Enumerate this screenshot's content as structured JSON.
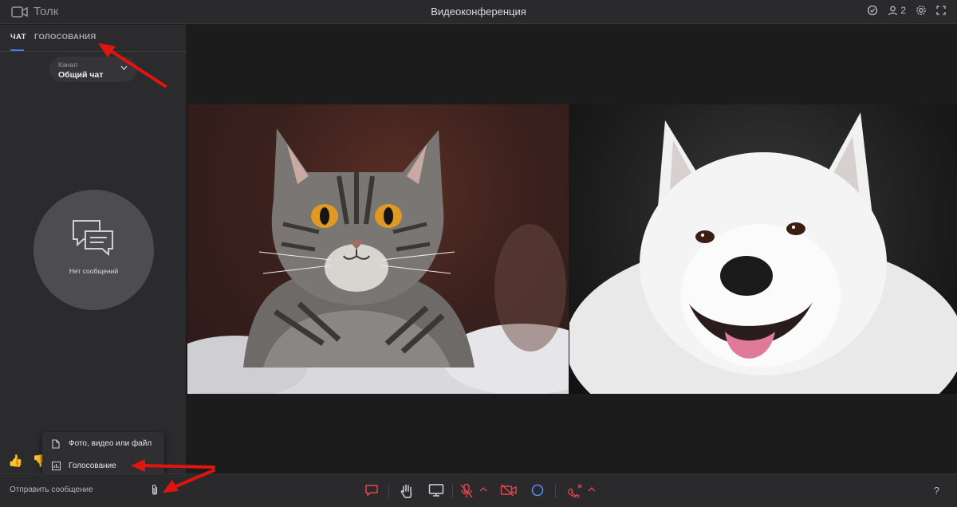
{
  "app": {
    "brand": "Толк",
    "title": "Видеоконференция",
    "participants_count": "2"
  },
  "sidebar": {
    "tabs": [
      {
        "label": "ЧАТ",
        "active": true
      },
      {
        "label": "ГОЛОСОВАНИЯ",
        "active": false
      }
    ],
    "channel": {
      "label": "Канал",
      "value": "Общий чат"
    },
    "empty_text": "Нет сообщений",
    "attach_menu": [
      {
        "label": "Фото, видео или файл",
        "icon": "file-icon"
      },
      {
        "label": "Голосование",
        "icon": "poll-icon"
      }
    ],
    "reactions": [
      "thumbs-up-icon",
      "thumbs-down-icon"
    ]
  },
  "composer": {
    "placeholder": "Отправить сообщение"
  },
  "controls": [
    "chat-icon",
    "raise-hand-icon",
    "screen-share-icon",
    "mic-muted-icon",
    "camera-off-icon",
    "record-icon",
    "end-call-icon"
  ],
  "help_label": "?",
  "colors": {
    "accent": "#3a82f6",
    "danger": "#e2474b",
    "annotation": "#e3130f"
  }
}
